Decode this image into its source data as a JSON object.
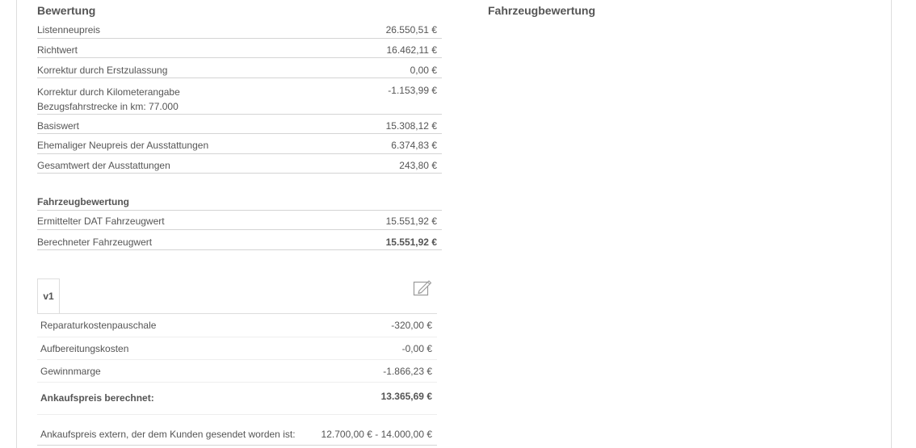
{
  "left": {
    "title": "Bewertung",
    "rows": [
      {
        "label": "Listenneupreis",
        "value": "26.550,51 €"
      },
      {
        "label": "Richtwert",
        "value": "16.462,11 €"
      },
      {
        "label": "Korrektur durch Erstzulassung",
        "value": "0,00 €"
      },
      {
        "label": "Korrektur durch Kilometerangabe",
        "sublabel": "Bezugsfahrstrecke in km: 77.000",
        "value": "-1.153,99 €"
      },
      {
        "label": "Basiswert",
        "value": "15.308,12 €"
      },
      {
        "label": "Ehemaliger Neupreis der Ausstattungen",
        "value": "6.374,83 €"
      },
      {
        "label": "Gesamtwert der Ausstattungen",
        "value": "243,80 €"
      }
    ],
    "fahrzeug": {
      "title": "Fahrzeugbewertung",
      "rows": [
        {
          "label": "Ermittelter DAT Fahrzeugwert",
          "value": "15.551,92 €"
        },
        {
          "label": "Berechneter Fahrzeugwert",
          "value": "15.551,92 €"
        }
      ]
    },
    "version": {
      "tab_label": "v1",
      "rows": [
        {
          "label": "Reparaturkostenpauschale",
          "value": "-320,00 €"
        },
        {
          "label": "Aufbereitungskosten",
          "value": "-0,00 €"
        },
        {
          "label": "Gewinnmarge",
          "value": "-1.866,23 €"
        }
      ],
      "total_label": "Ankaufspreis berechnet:",
      "total_value": "13.365,69 €",
      "extern_label": "Ankaufspreis extern, der dem Kunden gesendet worden ist:",
      "extern_value": "12.700,00 € - 14.000,00 €"
    }
  },
  "right": {
    "title": "Fahrzeugbewertung"
  },
  "icons": {
    "edit": "edit-icon"
  },
  "colors": {
    "accent": "#5b7fbf",
    "text": "#555555",
    "border": "#d4d4d4"
  }
}
